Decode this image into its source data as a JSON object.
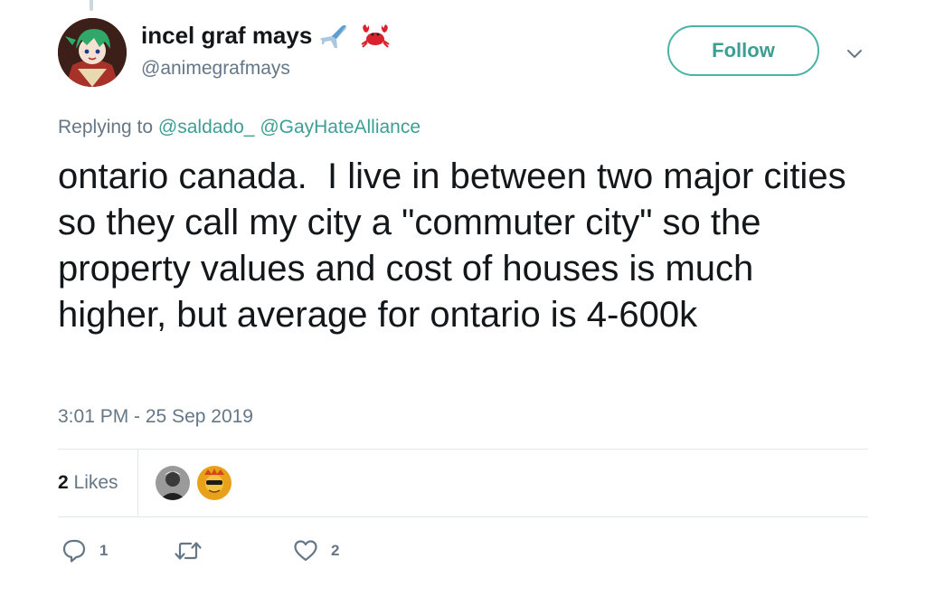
{
  "author": {
    "display_name": "incel graf mays",
    "handle": "@animegrafmays",
    "name_emoji": [
      "airplane-emoji",
      "crab-emoji"
    ],
    "avatar": "avatar-image"
  },
  "follow_button": {
    "label": "Follow"
  },
  "menu_icon": "chevron-down-icon",
  "reply_context": {
    "prefix": "Replying to",
    "mentions": [
      "@saldado_",
      "@GayHateAlliance"
    ]
  },
  "tweet": {
    "text": "ontario canada.  I live in between two major cities so they call my city a \"commuter city\" so the property values and cost of houses is much higher, but average for ontario is 4-600k",
    "timestamp": "3:01 PM - 25 Sep 2019"
  },
  "stats": {
    "likes_count": "2",
    "likes_label": "Likes",
    "likers": [
      "liker-avatar-1",
      "liker-avatar-2"
    ]
  },
  "actions": {
    "reply": {
      "icon": "reply-icon",
      "count": "1"
    },
    "retweet": {
      "icon": "retweet-icon",
      "count": ""
    },
    "like": {
      "icon": "heart-icon",
      "count": "2"
    }
  },
  "colors": {
    "accent": "#3d9f94",
    "text": "#14171a",
    "secondary": "#657786",
    "divider": "#e1e8ed"
  }
}
